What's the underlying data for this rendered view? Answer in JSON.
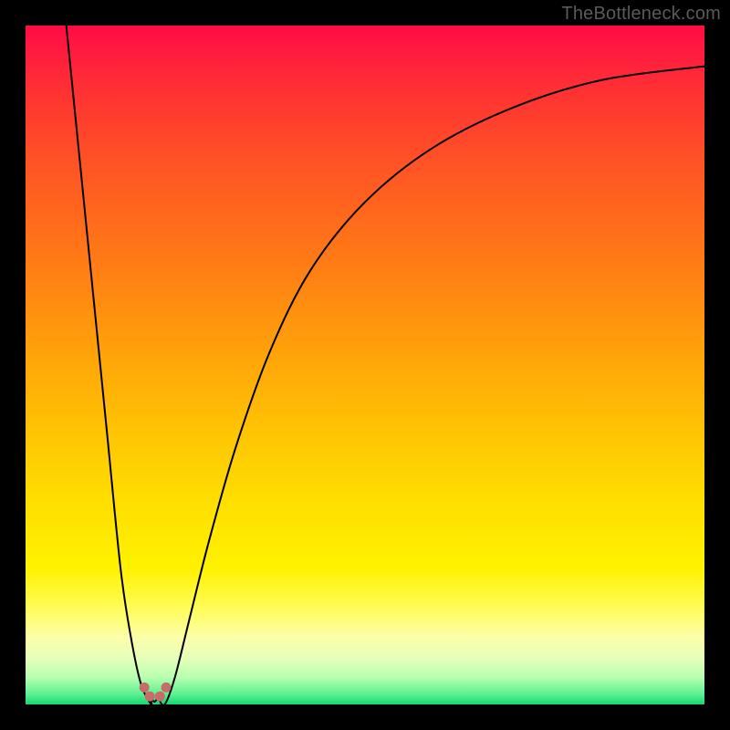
{
  "watermark": "TheBottleneck.com",
  "chart_data": {
    "type": "line",
    "title": "",
    "xlabel": "",
    "ylabel": "",
    "xlim": [
      0,
      100
    ],
    "ylim": [
      0,
      100
    ],
    "grid": false,
    "legend": false,
    "note": "Values approximated from pixel positions; no axis tick labels rendered.",
    "gradient_colors": {
      "top": "#ff0b45",
      "mid_upper": "#ff8a10",
      "mid": "#ffde00",
      "mid_lower": "#fffc5c",
      "bottom": "#12d876"
    },
    "series": [
      {
        "name": "left-branch",
        "x": [
          6,
          8,
          10,
          12,
          14,
          15.5,
          17,
          18.5
        ],
        "y": [
          100,
          80,
          60,
          40,
          20,
          10,
          3,
          0
        ]
      },
      {
        "name": "right-branch",
        "x": [
          20.5,
          22,
          24,
          27,
          31,
          36,
          42,
          50,
          60,
          72,
          85,
          100
        ],
        "y": [
          0,
          4,
          12,
          24,
          38,
          52,
          64,
          74,
          82,
          88,
          92,
          94
        ]
      }
    ],
    "points": [
      {
        "name": "valley-left",
        "x": 17.5,
        "y": 2.5
      },
      {
        "name": "valley-mid-l",
        "x": 18.3,
        "y": 1.2
      },
      {
        "name": "valley-mid-r",
        "x": 19.8,
        "y": 1.2
      },
      {
        "name": "valley-right",
        "x": 20.7,
        "y": 2.5
      }
    ],
    "valley_x": 19
  }
}
